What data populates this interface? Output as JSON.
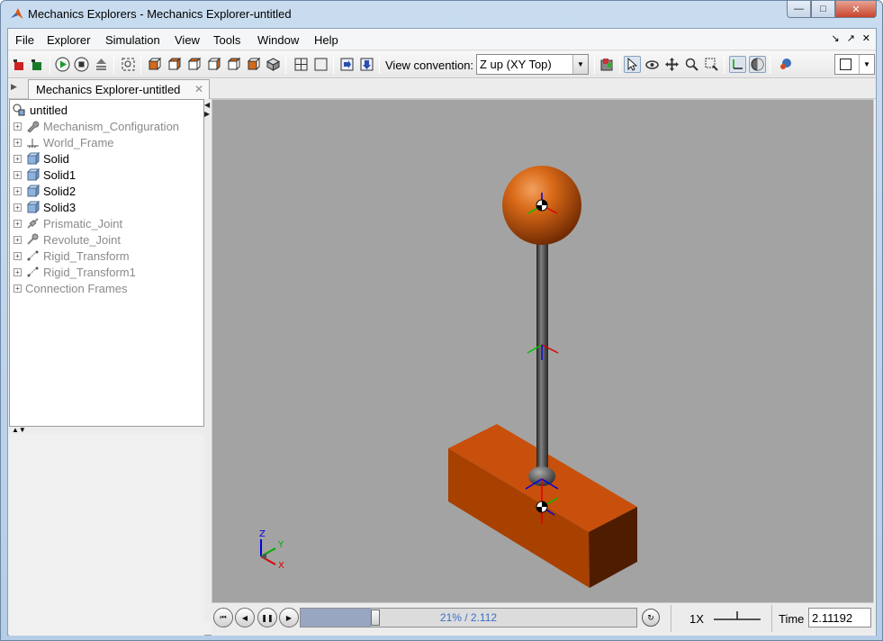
{
  "window": {
    "title": "Mechanics Explorers - Mechanics Explorer-untitled",
    "controls": {
      "minimize": "—",
      "maximize": "□",
      "close": "✕"
    }
  },
  "menu": {
    "items": [
      "File",
      "Explorer",
      "Simulation",
      "View",
      "Tools",
      "Window",
      "Help"
    ],
    "right_icons": [
      "undock-icon",
      "restore-icon",
      "close-icon"
    ]
  },
  "toolbar": {
    "view_convention_label": "View convention:",
    "view_convention_value": "Z up (XY Top)",
    "buttons": [
      "open-model-icon",
      "save-icon",
      "run-icon",
      "stop-icon",
      "step-icon",
      "fit-to-view-icon",
      "front-view-icon",
      "back-view-icon",
      "left-view-icon",
      "right-view-icon",
      "top-view-icon",
      "bottom-view-icon",
      "isometric-view-icon",
      "split-view-icon",
      "single-view-icon",
      "next-frame-icon",
      "previous-frame-icon",
      "color-icon",
      "select-icon",
      "rotate-icon",
      "pan-icon",
      "zoom-icon",
      "zoom-box-icon",
      "show-frames-icon",
      "toggle-shading-icon",
      "centre-of-mass-icon",
      "layout-icon"
    ]
  },
  "tab": {
    "label": "Mechanics Explorer-untitled",
    "close": "✕"
  },
  "tree": {
    "root": "untitled",
    "items": [
      {
        "label": "Mechanism_Configuration",
        "icon": "wrench-icon",
        "style": "grey"
      },
      {
        "label": "World_Frame",
        "icon": "world-frame-icon",
        "style": "grey"
      },
      {
        "label": "Solid",
        "icon": "solid-cube-icon",
        "style": "normal"
      },
      {
        "label": "Solid1",
        "icon": "solid-cube-icon",
        "style": "normal"
      },
      {
        "label": "Solid2",
        "icon": "solid-cube-icon",
        "style": "normal"
      },
      {
        "label": "Solid3",
        "icon": "solid-cube-icon",
        "style": "normal"
      },
      {
        "label": "Prismatic_Joint",
        "icon": "prismatic-joint-icon",
        "style": "grey"
      },
      {
        "label": "Revolute_Joint",
        "icon": "revolute-joint-icon",
        "style": "grey"
      },
      {
        "label": "Rigid_Transform",
        "icon": "rigid-transform-icon",
        "style": "grey"
      },
      {
        "label": "Rigid_Transform1",
        "icon": "rigid-transform-icon",
        "style": "grey"
      },
      {
        "label": "Connection Frames",
        "icon": "",
        "style": "grey"
      }
    ]
  },
  "viewport": {
    "background": "#a3a3a3",
    "axis_labels": {
      "z": "Z",
      "y": "Y",
      "x": "X"
    },
    "colors": {
      "body": "#c54a00",
      "rod": "#3c3c3c",
      "axis_x": "#e00000",
      "axis_y": "#00b000",
      "axis_z": "#0000e0"
    }
  },
  "playback": {
    "progress_fraction": 0.21,
    "slider_text": "21% / 2.112",
    "speed_label": "1X",
    "time_label": "Time",
    "time_value": "2.11192"
  }
}
